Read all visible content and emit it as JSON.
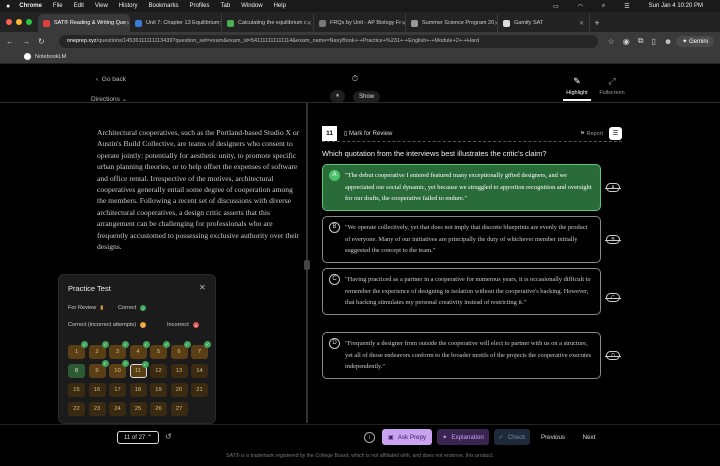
{
  "menubar": {
    "apple": "",
    "app": "Chrome",
    "items": [
      "File",
      "Edit",
      "View",
      "History",
      "Bookmarks",
      "Profiles",
      "Tab",
      "Window",
      "Help"
    ],
    "clock": "Sun Jan 4  10:20 PM"
  },
  "tabs": [
    {
      "label": "SAT® Reading & Writing Que",
      "active": true,
      "color": "#e04040"
    },
    {
      "label": "Unit 7: Chapter 13 Equilibrium",
      "active": false,
      "color": "#3a7bd5"
    },
    {
      "label": "Calculating the equilibrium c",
      "active": false,
      "color": "#4caf50"
    },
    {
      "label": "FRQs by Unit - AP Biology Fr",
      "active": false,
      "color": "#777"
    },
    {
      "label": "Summer Science Program 20",
      "active": false,
      "color": "#999"
    },
    {
      "label": "Gamify SAT",
      "active": false,
      "color": "#ddd"
    }
  ],
  "address": {
    "url_host": "oneprep.xyz",
    "url_path": "/questions/14536111111113439?question_set=exam&exam_id=541111111111114&exam_name=NavyBook+-+Practice+%231+-+English+-+Module+2+-+Hard",
    "gemini": "Gemini"
  },
  "bookmarks": {
    "notebook": "NotebookLM"
  },
  "header": {
    "go_back": "Go back",
    "directions": "Directions",
    "show": "Show",
    "highlight": "Highlight",
    "fullscreen": "Fullscreen"
  },
  "passage": "Architectural cooperatives, such as the Portland-based Studio X or Austin's Build Collective, are teams of designers who consent to operate jointly: potentially for aesthetic unity, to promote specific urban planning theories, or to help offset the expenses of software and office rental. Irrespective of the motives, architectural cooperatives generally entail some degree of cooperation among the members. Following a recent set of discussions with diverse architectural cooperatives, a design critic asserts that this arrangement can be challenging for professionals who are frequently accustomed to possessing exclusive authority over their designs.",
  "question": {
    "number": "11",
    "mark_label": "Mark for Review",
    "report": "Report",
    "abc": "ABC",
    "text": "Which quotation from the interviews best illustrates the critic's claim?",
    "options": [
      {
        "letter": "A",
        "text": "\"The debut cooperative I entered featured many exceptionally gifted designers, and we appreciated our social dynamic, yet because we struggled to apportion recognition and oversight for our drafts, the cooperative failed to endure.\""
      },
      {
        "letter": "B",
        "text": "\"We operate collectively, yet that does not imply that discrete blueprints are evenly the product of everyone. Many of our initiatives are principally the duty of whichever member initially suggested the concept to the team.\""
      },
      {
        "letter": "C",
        "text": "\"Having practiced as a partner in a cooperative for numerous years, it is occasionally difficult to remember the experience of designing in isolation without the cooperative's backing. However, that backing stimulates my personal creativity instead of restricting it.\""
      },
      {
        "letter": "D",
        "text": "\"Frequently a designer from outside the cooperative will elect to partner with us on a structure, yet all of those endeavors conform to the broader motifs of the projects the cooperative executes independently.\""
      }
    ],
    "selected": "A"
  },
  "practice": {
    "title": "Practice Test",
    "legend_review": "For Review",
    "legend_correct": "Correct",
    "legend_attempts": "Correct (incorrect attempts)",
    "legend_incorrect": "Incorrect",
    "cells": [
      "1",
      "2",
      "3",
      "4",
      "5",
      "6",
      "7",
      "8",
      "9",
      "10",
      "11",
      "12",
      "13",
      "14",
      "15",
      "16",
      "17",
      "18",
      "19",
      "20",
      "21",
      "22",
      "23",
      "24",
      "25",
      "26",
      "27"
    ]
  },
  "footer_nav": {
    "counter": "11 of 27",
    "ask": "Ask Prepy",
    "explanation": "Explanation",
    "check": "Check",
    "previous": "Previous",
    "next": "Next"
  },
  "footer": "SAT® is a trademark registered by the College Board, which is not affiliated with, and does not endorse, this product."
}
